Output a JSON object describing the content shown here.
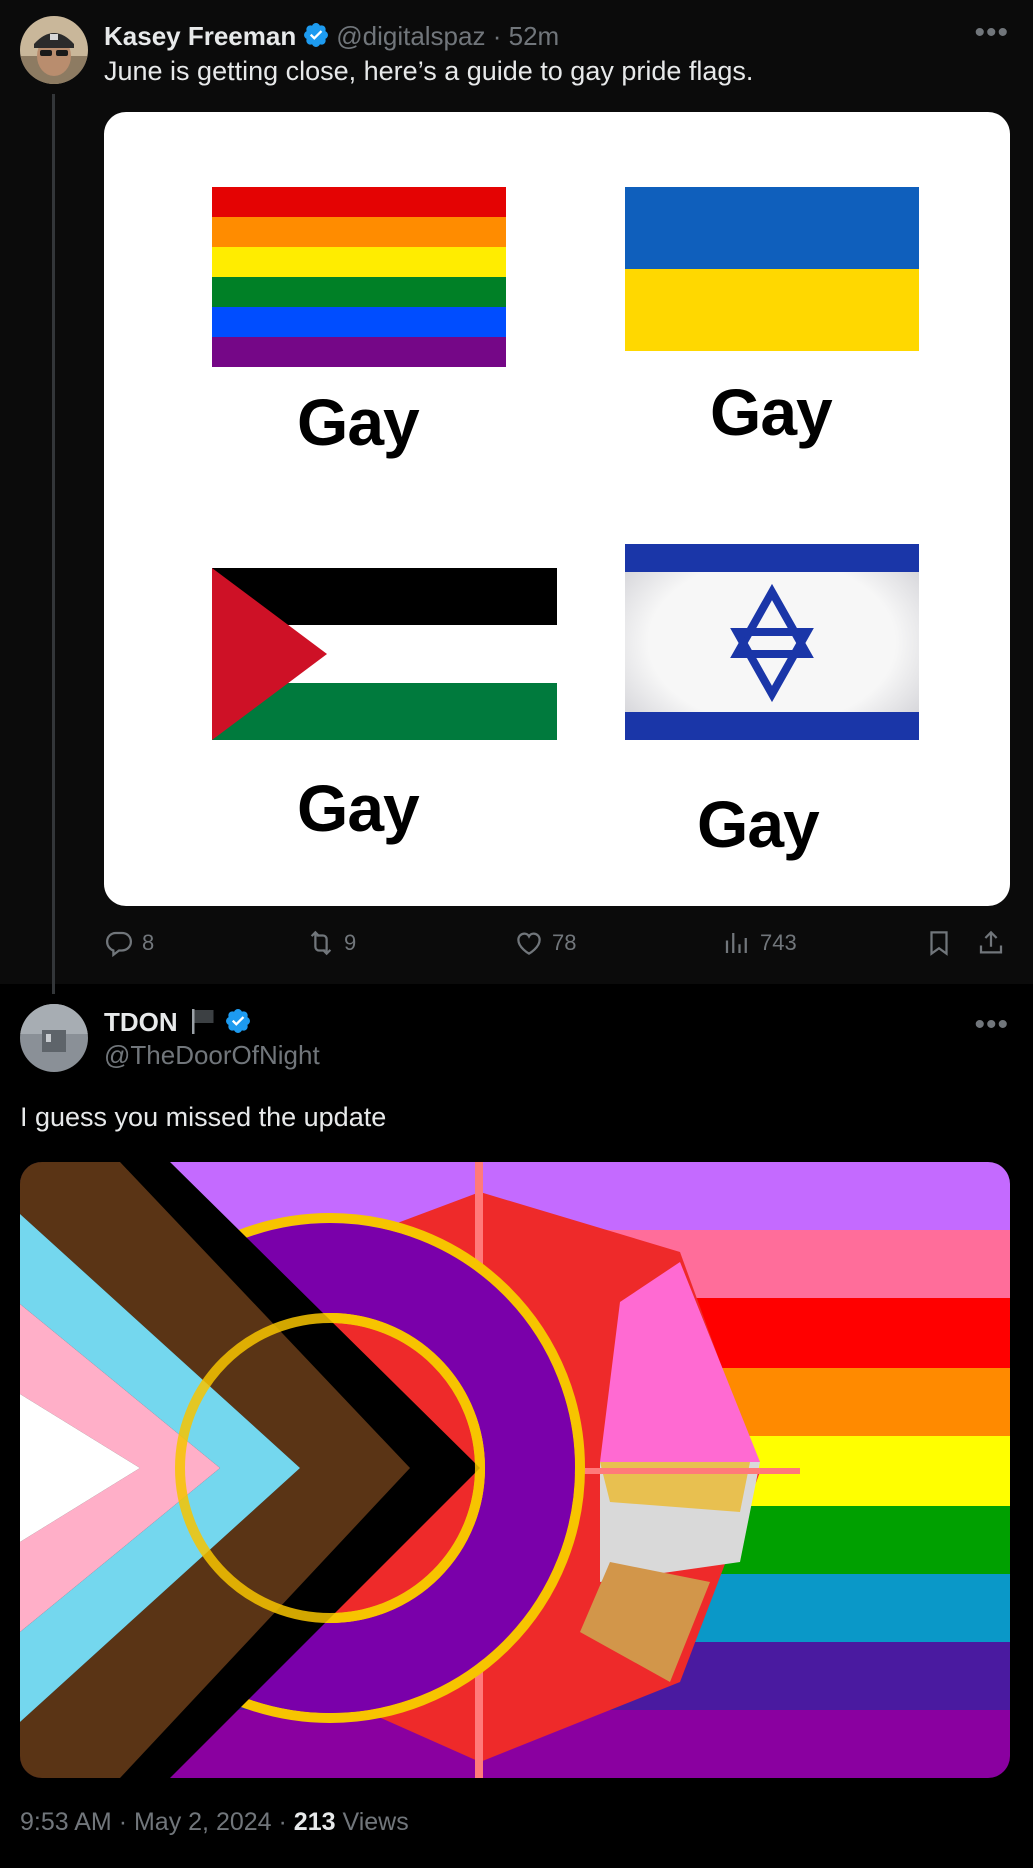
{
  "tweet1": {
    "display_name": "Kasey Freeman",
    "handle": "@digitalspaz",
    "separator": "·",
    "time": "52m",
    "text": "June is getting close, here’s a guide to gay pride flags.",
    "image_labels": [
      "Gay",
      "Gay",
      "Gay",
      "Gay"
    ],
    "actions": {
      "replies": "8",
      "reposts": "9",
      "likes": "78",
      "views": "743"
    }
  },
  "tweet2": {
    "display_name": "TDON",
    "handle": "@TheDoorOfNight",
    "text": "I guess you missed the update",
    "footer": {
      "time": "9:53 AM",
      "date": "May 2, 2024",
      "separator": "·",
      "views_count": "213",
      "views_label": "Views"
    }
  },
  "colors": {
    "verified_blue": "#1d9bf0",
    "muted_text": "#71767b",
    "primary_text": "#e7e9ea"
  },
  "icons": [
    "verified-badge-icon",
    "more-options-icon",
    "reply-icon",
    "repost-icon",
    "like-icon",
    "views-icon",
    "bookmark-icon",
    "share-icon",
    "flag-emoji-icon"
  ]
}
